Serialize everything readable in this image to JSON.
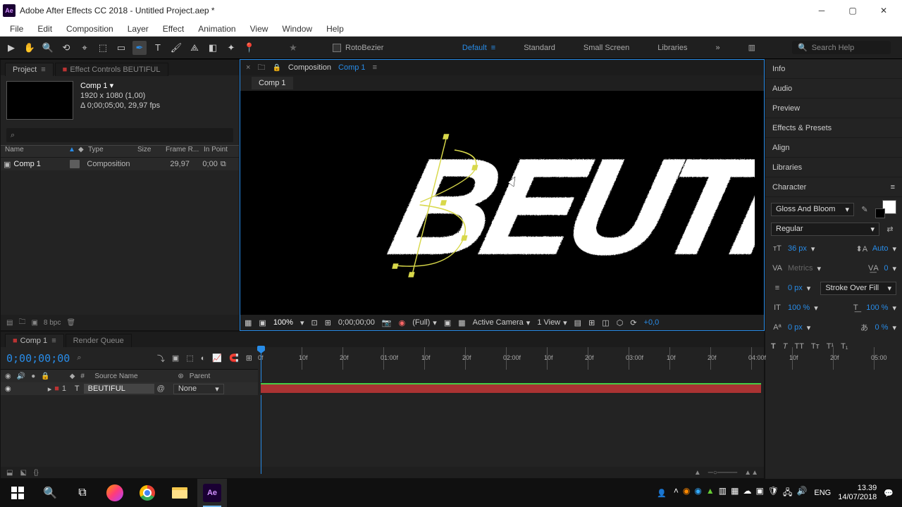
{
  "titlebar": {
    "title": "Adobe After Effects CC 2018 - Untitled Project.aep *"
  },
  "menubar": [
    "File",
    "Edit",
    "Composition",
    "Layer",
    "Effect",
    "Animation",
    "View",
    "Window",
    "Help"
  ],
  "toolbar": {
    "roto_label": "RotoBezier",
    "ws_default": "Default",
    "ws_standard": "Standard",
    "ws_small": "Small Screen",
    "ws_lib": "Libraries",
    "search_ph": "Search Help"
  },
  "project": {
    "tab_project": "Project",
    "tab_effect": "Effect Controls BEUTIFUL",
    "comp_name": "Comp 1 ▾",
    "comp_res": "1920 x 1080 (1,00)",
    "comp_dur": "Δ 0;00;05;00, 29,97 fps",
    "search_ph": "⌕",
    "hdr_name": "Name",
    "hdr_type": "Type",
    "hdr_size": "Size",
    "hdr_frame": "Frame R...",
    "hdr_in": "In Point",
    "row_name": "Comp 1",
    "row_type": "Composition",
    "row_fr": "29,97",
    "row_in": "0;00",
    "bpc": "8 bpc"
  },
  "viewer": {
    "comp_label": "Composition",
    "comp_link": "Comp 1",
    "subtab": "Comp 1",
    "zoom": "100%",
    "time": "0;00;00;00",
    "res": "(Full)",
    "camera": "Active Camera",
    "view": "1 View",
    "exp": "+0,0"
  },
  "right_panels": [
    "Info",
    "Audio",
    "Preview",
    "Effects & Presets",
    "Align",
    "Libraries",
    "Character"
  ],
  "character": {
    "font": "Gloss And Bloom",
    "weight": "Regular",
    "size": "36 px",
    "leading": "Auto",
    "kerning": "Metrics",
    "tracking": "0",
    "stroke_w": "0 px",
    "stroke_mode": "Stroke Over Fill",
    "vscale": "100 %",
    "hscale": "100 %",
    "baseline": "0 px",
    "tsume": "0 %"
  },
  "timeline": {
    "tab": "Comp 1",
    "tab_rq": "Render Queue",
    "timecode": "0;00;00;00",
    "hdr_num": "#",
    "hdr_src": "Source Name",
    "hdr_parent": "Parent",
    "layer_num": "1",
    "layer_name": "BEUTIFUL",
    "parent_val": "None",
    "ticks": [
      "0f",
      "10f",
      "20f",
      "01:00f",
      "10f",
      "20f",
      "02:00f",
      "10f",
      "20f",
      "03:00f",
      "10f",
      "20f",
      "04:00f",
      "10f",
      "20f",
      "05:00"
    ]
  },
  "taskbar": {
    "lang": "ENG",
    "time": "13.39",
    "date": "14/07/2018"
  }
}
